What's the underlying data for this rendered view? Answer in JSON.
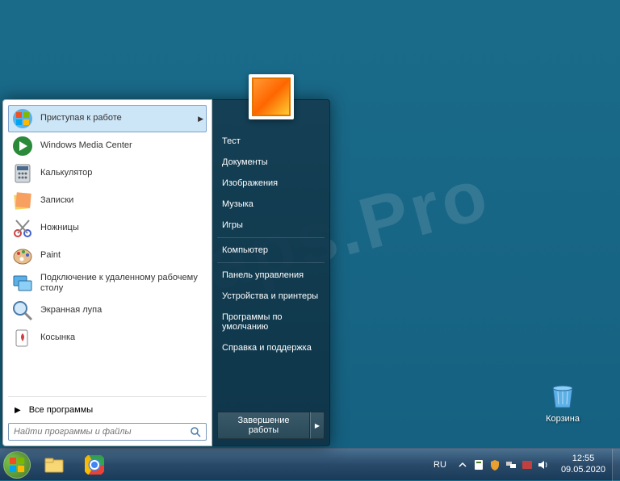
{
  "desktop": {
    "recycle_bin_label": "Корзина"
  },
  "watermark": "Fraps.Pro",
  "start_menu": {
    "left_items": [
      {
        "label": "Приступая к работе",
        "icon": "getting-started",
        "has_arrow": true,
        "highlighted": true
      },
      {
        "label": "Windows Media Center",
        "icon": "media-center"
      },
      {
        "label": "Калькулятор",
        "icon": "calculator"
      },
      {
        "label": "Записки",
        "icon": "sticky-notes"
      },
      {
        "label": "Ножницы",
        "icon": "snipping-tool"
      },
      {
        "label": "Paint",
        "icon": "paint"
      },
      {
        "label": "Подключение к удаленному рабочему столу",
        "icon": "remote-desktop"
      },
      {
        "label": "Экранная лупа",
        "icon": "magnifier"
      },
      {
        "label": "Косынка",
        "icon": "solitaire"
      }
    ],
    "all_programs_label": "Все программы",
    "search_placeholder": "Найти программы и файлы",
    "right_items_1": [
      "Тест",
      "Документы",
      "Изображения",
      "Музыка",
      "Игры"
    ],
    "right_items_2": [
      "Компьютер"
    ],
    "right_items_3": [
      "Панель управления",
      "Устройства и принтеры",
      "Программы по умолчанию",
      "Справка и поддержка"
    ],
    "shutdown_label": "Завершение работы"
  },
  "taskbar": {
    "lang": "RU",
    "time": "12:55",
    "date": "09.05.2020"
  }
}
